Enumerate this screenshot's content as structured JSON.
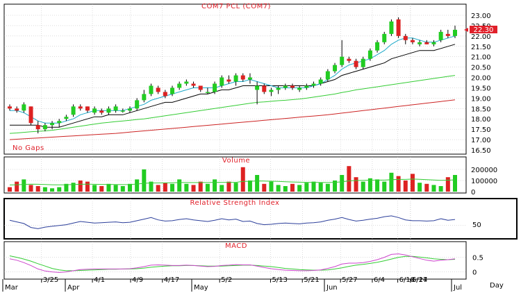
{
  "chart_data": {
    "type": "candlestick",
    "title": "COM7 PCL (COM7)",
    "note": "No Gaps",
    "x_axis_label": "Day",
    "x_dates": [
      "3/25",
      "4/1",
      "4/9",
      "4/17",
      "5/2",
      "5/13",
      "5/21",
      "5/27",
      "6/4",
      "6/10",
      "6/17",
      "6/24"
    ],
    "x_months": [
      "Mar",
      "Apr",
      "May",
      "Jun",
      "Jul"
    ],
    "last_price_label": "22.30",
    "colors": {
      "up": "#22cc22",
      "down": "#dd2222",
      "ma_short": "#1aa8c8",
      "ma_mid": "#000000",
      "ma_long": "#33cc33",
      "ma_xlong": "#cc2222",
      "rsi": "#2b3e9a",
      "macd": "#cc44cc",
      "signal": "#33cc33"
    },
    "price": {
      "ylim": [
        16.5,
        23.0
      ],
      "ticks": [
        "16.50",
        "17.00",
        "17.50",
        "18.00",
        "18.50",
        "19.00",
        "19.50",
        "20.00",
        "20.50",
        "21.00",
        "21.50",
        "22.00",
        "22.50",
        "23.00"
      ],
      "candles": [
        [
          18.6,
          18.7,
          18.4,
          18.5
        ],
        [
          18.5,
          18.6,
          18.3,
          18.4
        ],
        [
          18.4,
          18.8,
          18.3,
          18.7
        ],
        [
          18.6,
          18.6,
          17.7,
          17.8
        ],
        [
          17.7,
          17.9,
          17.3,
          17.5
        ],
        [
          17.5,
          17.8,
          17.4,
          17.7
        ],
        [
          17.7,
          17.9,
          17.5,
          17.8
        ],
        [
          17.8,
          18.0,
          17.6,
          17.9
        ],
        [
          18.0,
          18.2,
          17.9,
          18.1
        ],
        [
          18.2,
          18.7,
          18.1,
          18.6
        ],
        [
          18.6,
          18.7,
          18.4,
          18.5
        ],
        [
          18.6,
          18.6,
          18.3,
          18.4
        ],
        [
          18.3,
          18.6,
          18.2,
          18.5
        ],
        [
          18.4,
          18.5,
          18.2,
          18.3
        ],
        [
          18.3,
          18.6,
          18.2,
          18.5
        ],
        [
          18.4,
          18.7,
          18.3,
          18.6
        ],
        [
          18.4,
          18.5,
          18.3,
          18.4
        ],
        [
          18.4,
          18.6,
          18.3,
          18.5
        ],
        [
          18.5,
          19.0,
          18.4,
          18.9
        ],
        [
          18.9,
          19.4,
          18.8,
          19.2
        ],
        [
          19.2,
          19.7,
          19.1,
          19.6
        ],
        [
          19.5,
          19.6,
          19.2,
          19.3
        ],
        [
          19.3,
          19.4,
          19.0,
          19.1
        ],
        [
          19.2,
          19.6,
          19.1,
          19.5
        ],
        [
          19.5,
          19.8,
          19.4,
          19.7
        ],
        [
          19.7,
          19.9,
          19.6,
          19.8
        ],
        [
          19.7,
          19.8,
          19.5,
          19.6
        ],
        [
          19.6,
          19.6,
          19.3,
          19.4
        ],
        [
          19.3,
          19.5,
          19.2,
          19.3
        ],
        [
          19.3,
          19.8,
          19.2,
          19.7
        ],
        [
          19.6,
          20.1,
          19.5,
          20.0
        ],
        [
          19.9,
          20.1,
          19.7,
          19.8
        ],
        [
          19.8,
          20.2,
          19.6,
          20.1
        ],
        [
          20.1,
          20.2,
          19.8,
          19.9
        ],
        [
          19.9,
          20.2,
          19.7,
          20.0
        ],
        [
          19.4,
          19.8,
          18.7,
          19.6
        ],
        [
          19.6,
          19.7,
          19.2,
          19.3
        ],
        [
          19.3,
          19.5,
          19.1,
          19.4
        ],
        [
          19.4,
          19.6,
          19.2,
          19.5
        ],
        [
          19.5,
          19.7,
          19.4,
          19.6
        ],
        [
          19.6,
          19.7,
          19.4,
          19.5
        ],
        [
          19.4,
          19.6,
          19.3,
          19.5
        ],
        [
          19.5,
          19.7,
          19.4,
          19.6
        ],
        [
          19.6,
          19.8,
          19.5,
          19.7
        ],
        [
          19.7,
          20.0,
          19.6,
          19.9
        ],
        [
          19.9,
          20.4,
          19.8,
          20.3
        ],
        [
          20.3,
          20.7,
          20.2,
          20.6
        ],
        [
          20.6,
          21.8,
          20.5,
          21.0
        ],
        [
          20.9,
          21.0,
          20.7,
          20.8
        ],
        [
          20.8,
          20.9,
          20.4,
          20.5
        ],
        [
          20.5,
          21.0,
          20.4,
          20.9
        ],
        [
          20.9,
          21.4,
          20.8,
          21.3
        ],
        [
          21.3,
          21.8,
          21.2,
          21.7
        ],
        [
          21.7,
          22.2,
          21.6,
          22.1
        ],
        [
          22.1,
          22.8,
          22.0,
          22.7
        ],
        [
          22.8,
          22.9,
          21.9,
          22.0
        ],
        [
          22.0,
          22.1,
          21.6,
          21.8
        ],
        [
          21.8,
          21.9,
          21.6,
          21.7
        ],
        [
          21.6,
          21.8,
          21.5,
          21.7
        ],
        [
          21.7,
          21.8,
          21.6,
          21.6
        ],
        [
          21.6,
          21.8,
          21.5,
          21.7
        ],
        [
          21.8,
          22.3,
          21.7,
          22.2
        ],
        [
          22.1,
          22.3,
          21.9,
          22.0
        ],
        [
          22.0,
          22.5,
          21.9,
          22.3
        ]
      ],
      "ma_short": [
        18.4,
        18.4,
        18.3,
        18.1,
        17.9,
        17.8,
        17.8,
        17.8,
        17.9,
        18.0,
        18.2,
        18.3,
        18.4,
        18.4,
        18.4,
        18.4,
        18.4,
        18.5,
        18.6,
        18.7,
        18.9,
        19.0,
        19.1,
        19.2,
        19.3,
        19.4,
        19.5,
        19.5,
        19.5,
        19.5,
        19.6,
        19.7,
        19.8,
        19.8,
        19.9,
        19.8,
        19.7,
        19.6,
        19.5,
        19.5,
        19.5,
        19.5,
        19.5,
        19.6,
        19.7,
        19.9,
        20.1,
        20.4,
        20.6,
        20.7,
        20.8,
        20.9,
        21.1,
        21.3,
        21.6,
        21.8,
        21.9,
        21.9,
        21.8,
        21.7,
        21.7,
        21.8,
        21.9,
        22.0
      ],
      "ma_mid": [
        17.7,
        17.7,
        17.7,
        17.7,
        17.7,
        17.6,
        17.6,
        17.6,
        17.7,
        17.8,
        17.9,
        18.0,
        18.1,
        18.1,
        18.2,
        18.2,
        18.2,
        18.3,
        18.4,
        18.5,
        18.6,
        18.7,
        18.8,
        18.8,
        18.9,
        19.0,
        19.1,
        19.2,
        19.2,
        19.3,
        19.4,
        19.4,
        19.5,
        19.6,
        19.6,
        19.6,
        19.6,
        19.6,
        19.6,
        19.6,
        19.6,
        19.6,
        19.6,
        19.6,
        19.7,
        19.8,
        19.9,
        20.1,
        20.2,
        20.3,
        20.4,
        20.5,
        20.6,
        20.7,
        20.9,
        21.0,
        21.1,
        21.2,
        21.3,
        21.3,
        21.3,
        21.4,
        21.5,
        21.6
      ],
      "ma_long": [
        17.3,
        17.32,
        17.35,
        17.38,
        17.4,
        17.42,
        17.45,
        17.5,
        17.55,
        17.6,
        17.65,
        17.7,
        17.75,
        17.8,
        17.83,
        17.87,
        17.9,
        17.93,
        17.97,
        18.0,
        18.05,
        18.1,
        18.15,
        18.2,
        18.25,
        18.3,
        18.35,
        18.4,
        18.45,
        18.5,
        18.55,
        18.6,
        18.65,
        18.7,
        18.75,
        18.8,
        18.82,
        18.85,
        18.88,
        18.9,
        18.93,
        18.96,
        19.0,
        19.05,
        19.1,
        19.15,
        19.2,
        19.27,
        19.33,
        19.4,
        19.45,
        19.5,
        19.55,
        19.6,
        19.65,
        19.7,
        19.75,
        19.8,
        19.85,
        19.9,
        19.95,
        20.0,
        20.05,
        20.1
      ],
      "ma_xlong": [
        17.0,
        17.02,
        17.04,
        17.06,
        17.08,
        17.1,
        17.12,
        17.14,
        17.16,
        17.18,
        17.2,
        17.22,
        17.24,
        17.26,
        17.28,
        17.3,
        17.33,
        17.36,
        17.39,
        17.42,
        17.45,
        17.48,
        17.51,
        17.54,
        17.57,
        17.6,
        17.63,
        17.66,
        17.69,
        17.72,
        17.75,
        17.78,
        17.81,
        17.84,
        17.87,
        17.9,
        17.93,
        17.96,
        17.99,
        18.02,
        18.05,
        18.08,
        18.11,
        18.14,
        18.17,
        18.2,
        18.24,
        18.28,
        18.32,
        18.36,
        18.4,
        18.44,
        18.48,
        18.52,
        18.56,
        18.6,
        18.64,
        18.68,
        18.72,
        18.76,
        18.8,
        18.84,
        18.88,
        18.92
      ]
    },
    "volume": {
      "label": "Volume",
      "ymax": 250000,
      "ticks": [
        "200000",
        "100000",
        "0"
      ],
      "values": [
        40000,
        90000,
        110000,
        60000,
        50000,
        40000,
        30000,
        40000,
        70000,
        80000,
        100000,
        90000,
        60000,
        50000,
        70000,
        60000,
        50000,
        70000,
        110000,
        200000,
        90000,
        60000,
        80000,
        70000,
        110000,
        70000,
        60000,
        90000,
        70000,
        110000,
        60000,
        90000,
        80000,
        220000,
        100000,
        150000,
        70000,
        90000,
        60000,
        50000,
        70000,
        60000,
        80000,
        90000,
        80000,
        70000,
        100000,
        150000,
        230000,
        130000,
        90000,
        120000,
        110000,
        90000,
        170000,
        140000,
        100000,
        160000,
        80000,
        70000,
        60000,
        50000,
        130000,
        150000
      ],
      "avg": [
        60000,
        62000,
        65000,
        67000,
        66000,
        64000,
        62000,
        61000,
        62000,
        64000,
        66000,
        67000,
        66000,
        65000,
        65000,
        64000,
        63000,
        64000,
        68000,
        75000,
        78000,
        78000,
        79000,
        80000,
        82000,
        82000,
        81000,
        82000,
        82000,
        84000,
        83000,
        84000,
        84000,
        92000,
        93000,
        96000,
        95000,
        94000,
        92000,
        89000,
        87000,
        85000,
        84000,
        84000,
        83000,
        82000,
        84000,
        88000,
        97000,
        100000,
        101000,
        103000,
        104000,
        104000,
        108000,
        110000,
        110000,
        113000,
        111000,
        108000,
        105000,
        101000,
        103000,
        106000
      ]
    },
    "rsi": {
      "label": "Relative Strength Index",
      "ymax": 100,
      "tick": "50",
      "values": [
        63,
        59,
        55,
        45,
        42,
        46,
        48,
        50,
        52,
        56,
        60,
        58,
        56,
        57,
        58,
        59,
        57,
        58,
        62,
        66,
        70,
        64,
        61,
        62,
        65,
        67,
        64,
        62,
        60,
        63,
        67,
        64,
        66,
        60,
        61,
        55,
        52,
        53,
        55,
        56,
        55,
        54,
        56,
        57,
        59,
        63,
        66,
        70,
        65,
        61,
        63,
        66,
        68,
        72,
        74,
        70,
        64,
        62,
        62,
        61,
        62,
        67,
        63,
        65
      ]
    },
    "macd": {
      "label": "MACD",
      "ticks": [
        "0.5",
        "0"
      ],
      "ymin": -0.2,
      "ymax": 0.8,
      "macd_line": [
        0.45,
        0.4,
        0.32,
        0.22,
        0.1,
        0.03,
        0.0,
        -0.02,
        0.0,
        0.04,
        0.08,
        0.09,
        0.1,
        0.1,
        0.1,
        0.1,
        0.1,
        0.11,
        0.14,
        0.18,
        0.23,
        0.24,
        0.23,
        0.22,
        0.22,
        0.23,
        0.22,
        0.2,
        0.18,
        0.19,
        0.22,
        0.23,
        0.25,
        0.24,
        0.24,
        0.2,
        0.15,
        0.11,
        0.08,
        0.06,
        0.05,
        0.04,
        0.04,
        0.05,
        0.07,
        0.12,
        0.18,
        0.27,
        0.3,
        0.3,
        0.32,
        0.36,
        0.42,
        0.5,
        0.6,
        0.62,
        0.58,
        0.52,
        0.46,
        0.4,
        0.37,
        0.4,
        0.42,
        0.45
      ],
      "signal_line": [
        0.55,
        0.5,
        0.44,
        0.37,
        0.28,
        0.2,
        0.12,
        0.07,
        0.04,
        0.04,
        0.05,
        0.06,
        0.07,
        0.08,
        0.09,
        0.09,
        0.1,
        0.1,
        0.11,
        0.13,
        0.16,
        0.18,
        0.2,
        0.21,
        0.21,
        0.22,
        0.22,
        0.21,
        0.2,
        0.2,
        0.2,
        0.21,
        0.22,
        0.23,
        0.23,
        0.22,
        0.2,
        0.18,
        0.15,
        0.12,
        0.1,
        0.08,
        0.07,
        0.06,
        0.06,
        0.07,
        0.1,
        0.14,
        0.19,
        0.23,
        0.26,
        0.29,
        0.33,
        0.38,
        0.44,
        0.5,
        0.53,
        0.53,
        0.51,
        0.48,
        0.45,
        0.43,
        0.42,
        0.43
      ]
    }
  }
}
